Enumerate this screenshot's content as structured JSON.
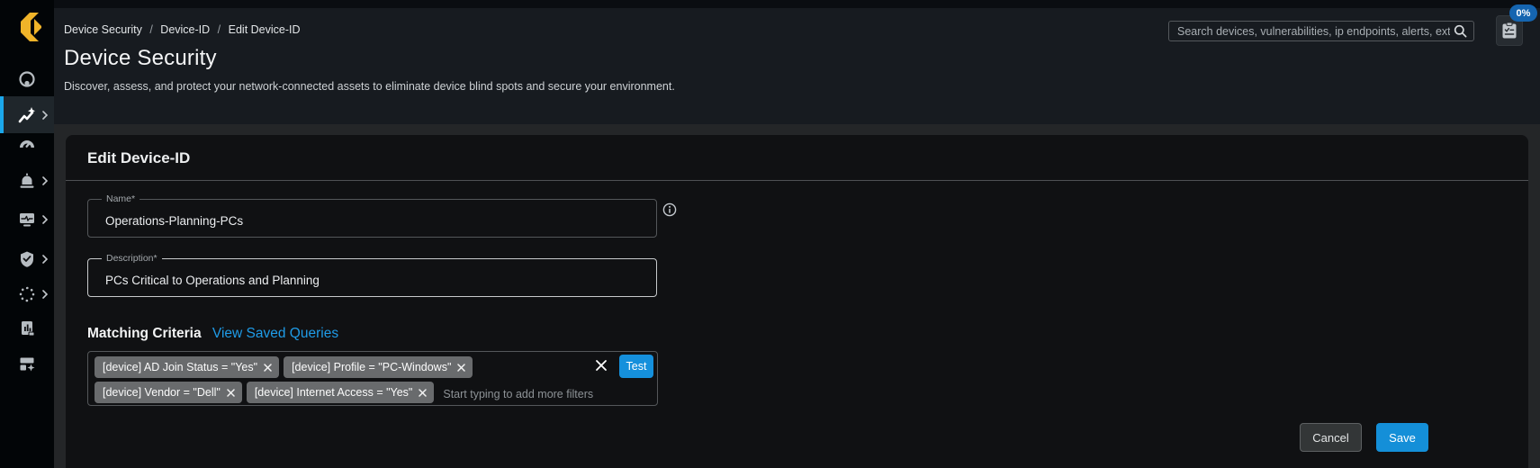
{
  "colors": {
    "accent_blue": "#1ba7ea",
    "link_blue": "#1f9ce8",
    "button_blue": "#148fd8",
    "badge_blue": "#1565b0",
    "logo_yellow": "#f0b429",
    "card_bg": "#101113",
    "header_bg": "#171b20",
    "content_bg": "#242628"
  },
  "sidebar": {
    "icons": [
      "target-icon",
      "route-icon",
      "gauge-icon",
      "alarm-icon",
      "monitor-pulse-icon",
      "shield-check-icon",
      "dotted-circle-icon",
      "report-icon",
      "blocks-sparkle-icon"
    ]
  },
  "header": {
    "breadcrumb": [
      "Device Security",
      "Device-ID",
      "Edit Device-ID"
    ],
    "breadcrumb_separator": "/",
    "title": "Device Security",
    "subtitle": "Discover, assess, and protect your network-connected assets to eliminate device blind spots and secure your environment.",
    "search_placeholder": "Search devices, vulnerabilities, ip endpoints, alerts, exter…",
    "progress_badge": "0%"
  },
  "panel": {
    "title": "Edit Device-ID",
    "name_label": "Name*",
    "name_value": "Operations-Planning-PCs",
    "description_label": "Description*",
    "description_value": "PCs Critical to Operations and Planning",
    "matching_criteria_label": "Matching Criteria",
    "view_saved_queries_label": "View Saved Queries",
    "filters": [
      "[device] AD Join Status = \"Yes\"",
      "[device] Profile = \"PC-Windows\"",
      "[device] Vendor = \"Dell\"",
      "[device] Internet Access = \"Yes\""
    ],
    "filter_placeholder": "Start typing to add more filters",
    "test_label": "Test",
    "cancel_label": "Cancel",
    "save_label": "Save"
  }
}
